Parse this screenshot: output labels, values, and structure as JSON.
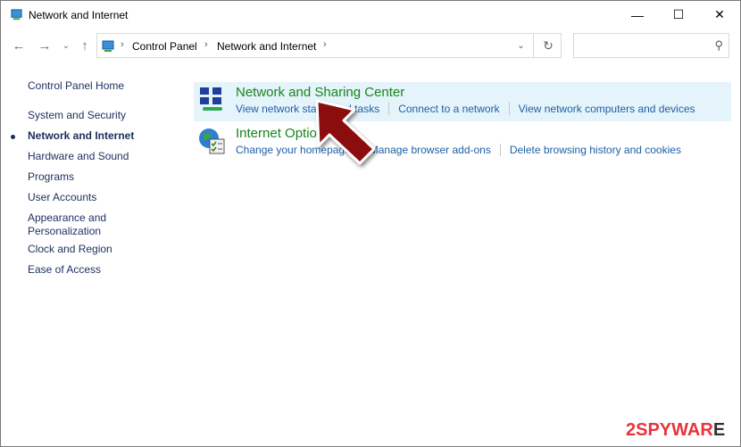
{
  "window": {
    "title": "Network and Internet",
    "controls": {
      "minimize": "—",
      "maximize": "☐",
      "close": "✕"
    }
  },
  "nav": {
    "back": "←",
    "forward": "→",
    "recent": "⌄",
    "up": "↑",
    "breadcrumb": [
      "Control Panel",
      "Network and Internet"
    ],
    "separator": "›",
    "dropdown": "⌄",
    "refresh": "↻",
    "search_placeholder": "",
    "search_icon": "⚲"
  },
  "sidebar": {
    "items": [
      {
        "label": "Control Panel Home",
        "active": false
      },
      {
        "label": "System and Security",
        "active": false
      },
      {
        "label": "Network and Internet",
        "active": true
      },
      {
        "label": "Hardware and Sound",
        "active": false
      },
      {
        "label": "Programs",
        "active": false
      },
      {
        "label": "User Accounts",
        "active": false
      },
      {
        "label": "Appearance and",
        "label2": "Personalization",
        "active": false
      },
      {
        "label": "Clock and Region",
        "active": false
      },
      {
        "label": "Ease of Access",
        "active": false
      }
    ]
  },
  "categories": [
    {
      "title": "Network and Sharing Center",
      "icon": "network-sharing-icon",
      "links": [
        "View network status and tasks",
        "Connect to a network",
        "View network computers and devices"
      ]
    },
    {
      "title": "Internet Options",
      "icon": "internet-options-icon",
      "links": [
        "Change your homepage",
        "Manage browser add-ons",
        "Delete browsing history and cookies"
      ]
    }
  ],
  "colors": {
    "title_green": "#18851e",
    "link_blue": "#1e5fa8",
    "highlight": "#e5f3fb",
    "arrow": "#8b0a0a"
  },
  "watermark": {
    "part1": "2SPY",
    "part2": "WAR",
    "part3": "E"
  }
}
